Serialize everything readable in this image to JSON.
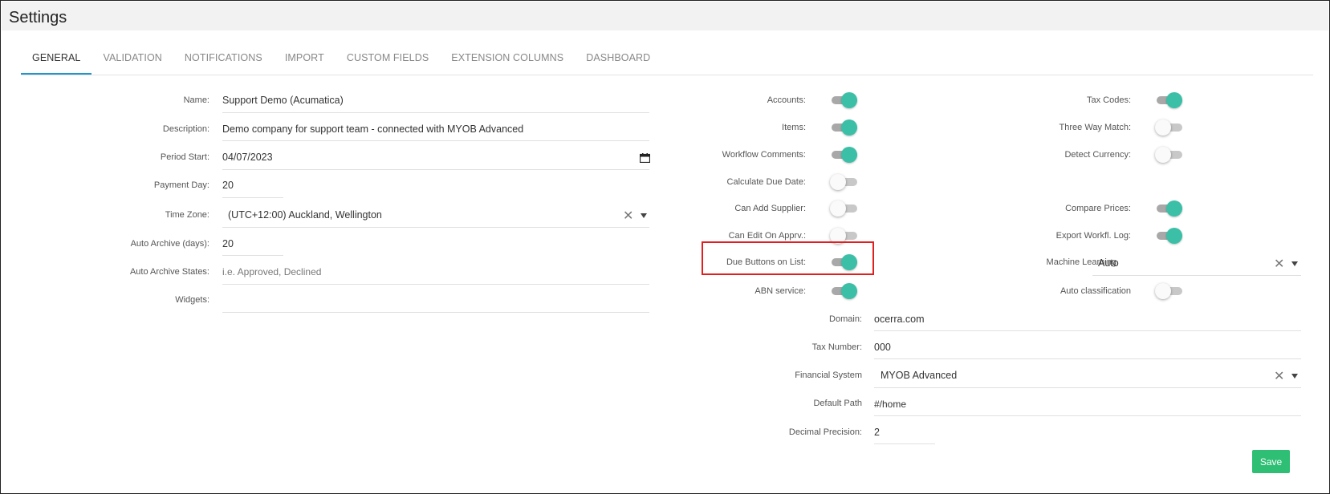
{
  "page": {
    "title": "Settings"
  },
  "tabs": [
    {
      "label": "GENERAL",
      "active": true
    },
    {
      "label": "VALIDATION",
      "active": false
    },
    {
      "label": "NOTIFICATIONS",
      "active": false
    },
    {
      "label": "IMPORT",
      "active": false
    },
    {
      "label": "CUSTOM FIELDS",
      "active": false
    },
    {
      "label": "EXTENSION COLUMNS",
      "active": false
    },
    {
      "label": "DASHBOARD",
      "active": false
    }
  ],
  "general": {
    "name": {
      "label": "Name:",
      "value": "Support Demo (Acumatica)"
    },
    "description": {
      "label": "Description:",
      "value": "Demo company for support team - connected with MYOB Advanced"
    },
    "period_start": {
      "label": "Period Start:",
      "value": "04/07/2023"
    },
    "payment_day": {
      "label": "Payment Day:",
      "value": "20"
    },
    "time_zone": {
      "label": "Time Zone:",
      "value": "(UTC+12:00) Auckland, Wellington"
    },
    "auto_archive_days": {
      "label": "Auto Archive (days):",
      "value": "20"
    },
    "auto_archive_states": {
      "label": "Auto Archive States:",
      "placeholder": "i.e. Approved, Declined"
    },
    "widgets": {
      "label": "Widgets:",
      "value": ""
    }
  },
  "toggles_mid": [
    {
      "label": "Accounts:",
      "on": true
    },
    {
      "label": "Items:",
      "on": true
    },
    {
      "label": "Workflow Comments:",
      "on": true
    },
    {
      "label": "Calculate Due Date:",
      "on": false
    },
    {
      "label": "Can Add Supplier:",
      "on": false
    },
    {
      "label": "Can Edit On Apprv.:",
      "on": false
    },
    {
      "label": "Due Buttons on List:",
      "on": true
    },
    {
      "label": "ABN service:",
      "on": true
    }
  ],
  "toggles_right": {
    "tax_codes": {
      "label": "Tax Codes:",
      "on": true
    },
    "three_way_match": {
      "label": "Three Way Match:",
      "on": false
    },
    "detect_currency": {
      "label": "Detect Currency:",
      "on": false
    },
    "compare_prices": {
      "label": "Compare Prices:",
      "on": true
    },
    "export_workfl_log": {
      "label": "Export Workfl. Log:",
      "on": true
    },
    "auto_classification": {
      "label": "Auto classification",
      "on": false
    }
  },
  "machine_learning": {
    "label": "Machine Learning",
    "value": "Auto"
  },
  "system": {
    "domain": {
      "label": "Domain:",
      "value": "ocerra.com"
    },
    "tax_number": {
      "label": "Tax Number:",
      "value": "000"
    },
    "financial_system": {
      "label": "Financial System",
      "value": "MYOB Advanced"
    },
    "default_path": {
      "label": "Default Path",
      "value": "#/home"
    },
    "decimal_precision": {
      "label": "Decimal Precision:",
      "value": "2"
    }
  },
  "actions": {
    "save_label": "Save"
  },
  "icons": {
    "clear": "✕",
    "caret": "caret-down-icon",
    "calendar": "calendar-icon"
  },
  "colors": {
    "toggle_on": "#3bbfa7",
    "tab_active_underline": "#2196c8",
    "save_button": "#2ebf74",
    "highlight": "#e02020"
  }
}
